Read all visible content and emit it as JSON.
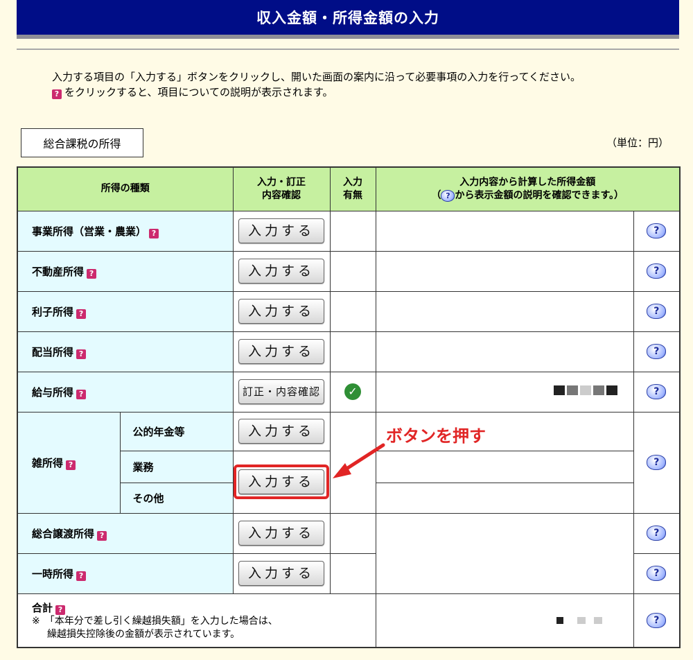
{
  "header": {
    "title": "収入金額・所得金額の入力"
  },
  "instructions": {
    "line1": "入力する項目の「入力する」ボタンをクリックし、開いた画面の案内に沿って必要事項の入力を行ってください。",
    "line2": "をクリックすると、項目についての説明が表示されます。"
  },
  "section": {
    "label": "総合課税の所得",
    "unit": "（単位：円）"
  },
  "table": {
    "headers": {
      "type": "所得の種類",
      "entry_line1": "入力・訂正",
      "entry_line2": "内容確認",
      "has_input_line1": "入力",
      "has_input_line2": "有無",
      "amount_line1": "入力内容から計算した所得金額",
      "amount_line2a": "（",
      "amount_line2b": "から表示金額の説明を確認できます。）"
    },
    "rows": [
      {
        "label": "事業所得（営業・農業）",
        "button": "入力する"
      },
      {
        "label": "不動産所得",
        "button": "入力する"
      },
      {
        "label": "利子所得",
        "button": "入力する"
      },
      {
        "label": "配当所得",
        "button": "入力する"
      },
      {
        "label": "給与所得",
        "button": "訂正・内容確認"
      },
      {
        "label": "雑所得",
        "sub1": "公的年金等",
        "sub2": "業務",
        "sub3": "その他",
        "button1": "入力する",
        "button2": "入力する"
      },
      {
        "label": "総合譲渡所得",
        "button": "入力する"
      },
      {
        "label": "一時所得",
        "button": "入力する"
      }
    ],
    "total": {
      "label": "合計",
      "note_line1": "※　「本年分で差し引く繰越損失額」を入力した場合は、",
      "note_line2": "繰越損失控除後の金額が表示されています。"
    }
  },
  "annotation": {
    "text": "ボタンを押す",
    "color": "#e12525"
  },
  "icons": {
    "help_square": "?",
    "help_bubble": "?",
    "check": "✓"
  }
}
